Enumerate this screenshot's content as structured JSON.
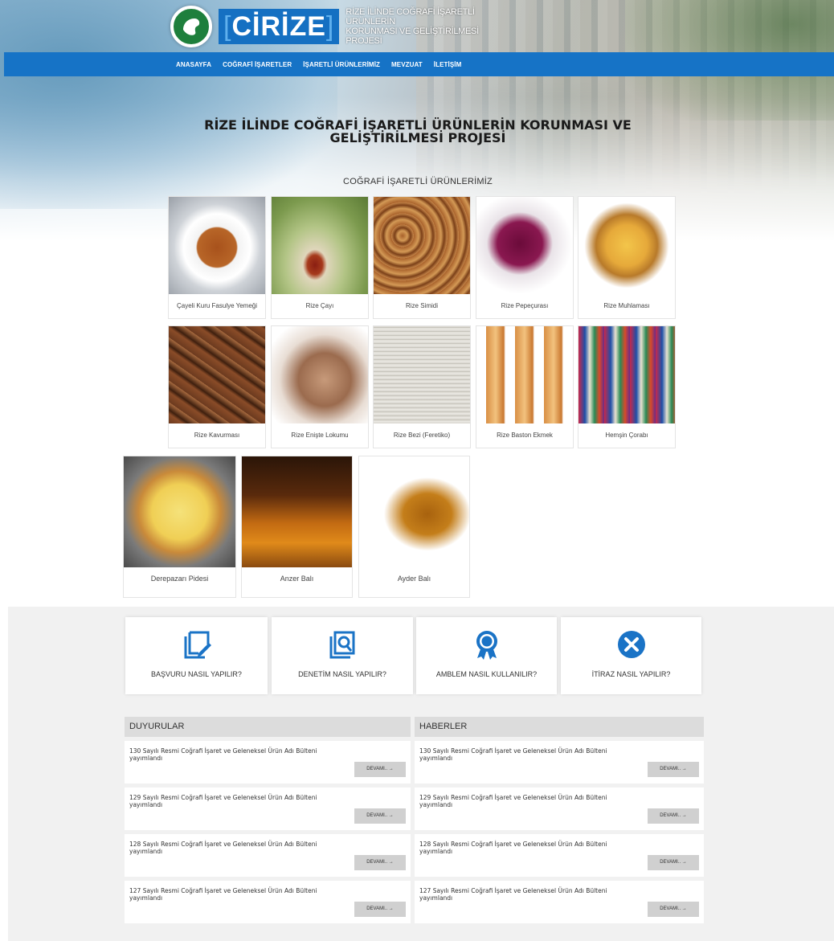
{
  "header": {
    "logo_text": "CİRİZE",
    "logo_subtitle_line1": "RİZE İLİNDE COĞRAFİ İŞARETLİ ÜRÜNLERİN",
    "logo_subtitle_line2": "KORUNMASI VE GELİŞTİRİLMESİ PROJESİ"
  },
  "nav": {
    "items": [
      "ANASAYFA",
      "COĞRAFİ İŞARETLER",
      "İŞARETLİ ÜRÜNLERİMİZ",
      "MEVZUAT",
      "İLETİŞİM"
    ]
  },
  "hero": {
    "title_line1": "RİZE İLİNDE COĞRAFİ İŞARETLİ ÜRÜNLERİN KORUNMASI VE",
    "title_line2": "GELİŞTİRİLMESİ PROJESİ",
    "section_title": "COĞRAFİ İŞARETLİ ÜRÜNLERİMİZ"
  },
  "products": [
    "Çayeli Kuru Fasulye Yemeği",
    "Rize Çayı",
    "Rize Simidi",
    "Rize Pepeçurası",
    "Rize Muhlaması",
    "Rize Kavurması",
    "Rize Enişte Lokumu",
    "Rize Bezi (Feretiko)",
    "Rize Baston Ekmek",
    "Hemşin Çorabı",
    "Derepazarı Pidesi",
    "Anzer Balı",
    "Ayder Balı"
  ],
  "info_boxes": [
    {
      "label": "BAŞVURU NASIL YAPILIR?",
      "icon": "edit-document-icon"
    },
    {
      "label": "DENETİM NASIL YAPILIR?",
      "icon": "document-search-icon"
    },
    {
      "label": "AMBLEM NASIL KULLANILIR?",
      "icon": "award-badge-icon"
    },
    {
      "label": "İTİRAZ NASIL YAPILIR?",
      "icon": "close-circle-icon"
    }
  ],
  "colors": {
    "nav_bg": "#1673c6",
    "accent_blue": "#1a73c6",
    "logo_green": "#1e7f3c"
  },
  "announcements": {
    "title": "DUYURULAR",
    "items": [
      {
        "line1": "130 Sayılı Resmi Coğrafi İşaret ve Geleneksel Ürün Adı Bülteni",
        "line2": "yayımlandı",
        "more": "DEVAMI.. →"
      },
      {
        "line1": "129 Sayılı Resmi Coğrafi İşaret ve Geleneksel Ürün Adı Bülteni",
        "line2": "yayımlandı",
        "more": "DEVAMI.. →"
      },
      {
        "line1": "128 Sayılı Resmi Coğrafi İşaret ve Geleneksel Ürün Adı Bülteni",
        "line2": "yayımlandı",
        "more": "DEVAMI.. →"
      },
      {
        "line1": "127 Sayılı Resmi Coğrafi İşaret ve Geleneksel Ürün Adı Bülteni",
        "line2": "yayımlandı",
        "more": "DEVAMI.. →"
      }
    ]
  },
  "news": {
    "title": "HABERLER",
    "items": [
      {
        "line1": "130 Sayılı Resmi Coğrafi İşaret ve Geleneksel Ürün Adı Bülteni",
        "line2": "yayımlandı",
        "more": "DEVAMI.. →"
      },
      {
        "line1": "129 Sayılı Resmi Coğrafi İşaret ve Geleneksel Ürün Adı Bülteni",
        "line2": "yayımlandı",
        "more": "DEVAMI.. →"
      },
      {
        "line1": "128 Sayılı Resmi Coğrafi İşaret ve Geleneksel Ürün Adı Bülteni",
        "line2": "yayımlandı",
        "more": "DEVAMI.. →"
      },
      {
        "line1": "127 Sayılı Resmi Coğrafi İşaret ve Geleneksel Ürün Adı Bülteni",
        "line2": "yayımlandı",
        "more": "DEVAMI.. →"
      }
    ]
  }
}
